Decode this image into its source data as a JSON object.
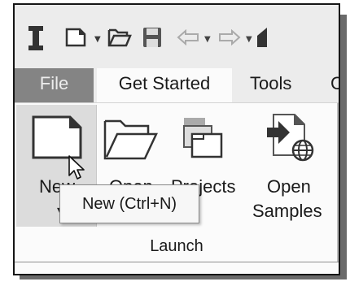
{
  "quick_access_toolbar": {
    "icons": [
      "app-logo-icon",
      "new-document-icon",
      "dropdown-arrow-icon",
      "open-folder-icon",
      "save-icon",
      "undo-icon",
      "dropdown-arrow-icon",
      "redo-icon",
      "dropdown-arrow-icon",
      "home-icon"
    ]
  },
  "menu_tabs": [
    {
      "label": "File"
    },
    {
      "label": "Get Started",
      "active": true
    },
    {
      "label": "Tools"
    },
    {
      "label": "C"
    }
  ],
  "ribbon": {
    "buttons": [
      {
        "label_line1": "New",
        "label_line2": "",
        "icon": "new-document-icon",
        "has_dropdown": true
      },
      {
        "label_line1": "Open",
        "label_line2": "",
        "icon": "open-folder-icon"
      },
      {
        "label_line1": "Projects",
        "label_line2": "",
        "icon": "projects-icon"
      },
      {
        "label_line1": "Open",
        "label_line2": "Samples",
        "icon": "open-samples-icon"
      }
    ],
    "group_label": "Launch"
  },
  "tooltip": {
    "text": "New (Ctrl+N)"
  },
  "colors": {
    "file_tab_bg": "#848484",
    "active_tab_bg": "#fbfbfb",
    "toolbar_bg": "#ececec",
    "hover_bg": "#dcdcdc"
  }
}
